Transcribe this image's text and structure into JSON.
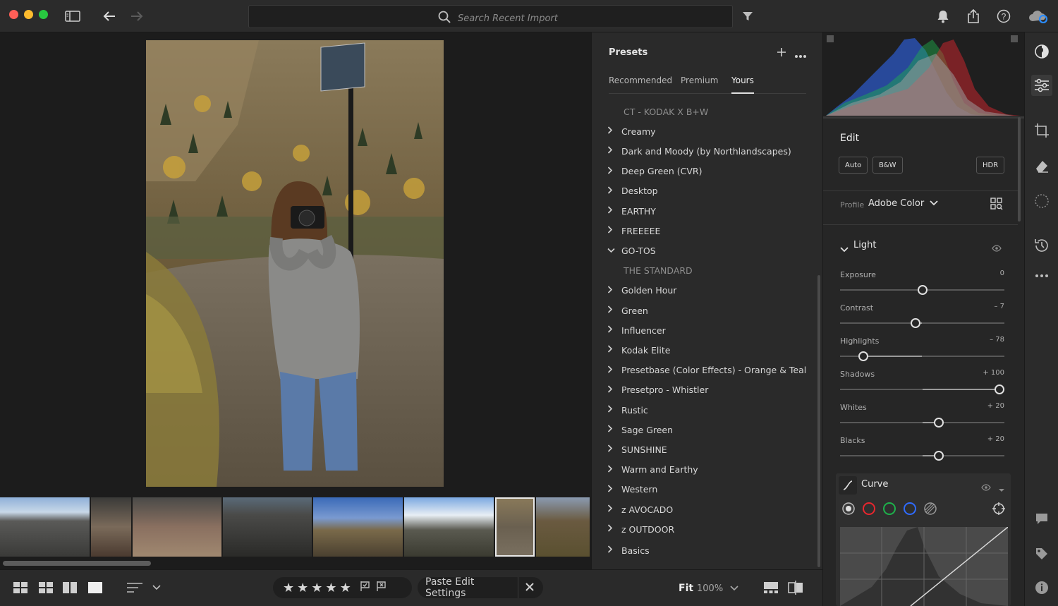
{
  "titlebar": {
    "search_placeholder": "Search Recent Import",
    "icons": [
      "sidebar-toggle-icon",
      "back-arrow-icon",
      "forward-arrow-icon",
      "filter-icon",
      "bell-icon",
      "share-icon",
      "help-icon",
      "cloud-sync-icon"
    ]
  },
  "presets": {
    "title": "Presets",
    "tabs": [
      {
        "label": "Recommended",
        "active": false
      },
      {
        "label": "Premium",
        "active": false
      },
      {
        "label": "Yours",
        "active": true
      }
    ],
    "items": [
      {
        "label": "CT - KODAK X B+W",
        "type": "sub"
      },
      {
        "label": "Creamy",
        "type": "group"
      },
      {
        "label": "Dark and Moody (by Northlandscapes)",
        "type": "group"
      },
      {
        "label": "Deep Green (CVR)",
        "type": "group"
      },
      {
        "label": "Desktop",
        "type": "group"
      },
      {
        "label": "EARTHY",
        "type": "group"
      },
      {
        "label": "FREEEEE",
        "type": "group"
      },
      {
        "label": "GO-TOS",
        "type": "group-open"
      },
      {
        "label": "THE STANDARD",
        "type": "sub"
      },
      {
        "label": "Golden Hour",
        "type": "group"
      },
      {
        "label": "Green",
        "type": "group"
      },
      {
        "label": "Influencer",
        "type": "group"
      },
      {
        "label": "Kodak Elite",
        "type": "group"
      },
      {
        "label": "Presetbase (Color Effects) - Orange & Teal",
        "type": "group"
      },
      {
        "label": "Presetpro - Whistler",
        "type": "group"
      },
      {
        "label": "Rustic",
        "type": "group"
      },
      {
        "label": "Sage Green",
        "type": "group"
      },
      {
        "label": "SUNSHINE",
        "type": "group"
      },
      {
        "label": "Warm and Earthy",
        "type": "group"
      },
      {
        "label": "Western",
        "type": "group"
      },
      {
        "label": "z AVOCADO",
        "type": "group"
      },
      {
        "label": "z OUTDOOR",
        "type": "group"
      },
      {
        "label": "Basics",
        "type": "group"
      }
    ]
  },
  "edit": {
    "title": "Edit",
    "auto_label": "Auto",
    "bw_label": "B&W",
    "hdr_label": "HDR",
    "profile_label": "Profile",
    "profile_value": "Adobe Color",
    "light_title": "Light",
    "sliders": [
      {
        "label": "Exposure",
        "value": "0",
        "position": 0.5
      },
      {
        "label": "Contrast",
        "value": "– 7",
        "position": 0.46
      },
      {
        "label": "Highlights",
        "value": "– 78",
        "position": 0.14
      },
      {
        "label": "Shadows",
        "value": "+ 100",
        "position": 1.0
      },
      {
        "label": "Whites",
        "value": "+ 20",
        "position": 0.6
      },
      {
        "label": "Blacks",
        "value": "+ 20",
        "position": 0.6
      }
    ],
    "curve_title": "Curve"
  },
  "bottombar": {
    "stars": [
      "★",
      "★",
      "★",
      "★",
      "★"
    ],
    "paste_label": "Paste Edit Settings",
    "fit_label": "Fit",
    "zoom_label": "100%"
  },
  "colors": {
    "accent_cloud": "#2a8cff",
    "histogram_red": "#e8262e",
    "histogram_green": "#1db24b",
    "histogram_blue": "#2f6bff"
  }
}
